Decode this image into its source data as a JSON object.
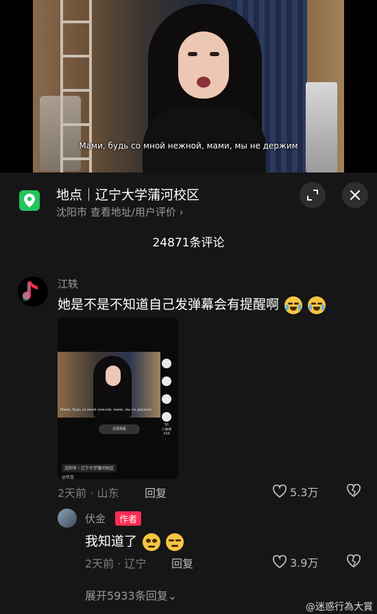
{
  "video": {
    "subtitle": "Мами, будь со мной нежной, мами, мы не держим"
  },
  "location": {
    "title": "地点｜辽宁大学蒲河校区",
    "subtitle": "沈阳市  查看地址/用户评价 ›",
    "icon": "map-pin-icon",
    "accent_color": "#22c55e"
  },
  "comments_header": {
    "count_label": "24871条评论"
  },
  "comment": {
    "username": "江轶",
    "text": "她是不是不知道自己发弹幕会有提醒啊",
    "thumbnail": {
      "subtitle": "Мами, будь со мной нежной, мами, мы не держим",
      "location": "沈阳市｜辽宁大学蒲河校区",
      "user": "@伏金",
      "rail_counts": [
        "56",
        "少推荐",
        "438"
      ],
      "button": "全屏观看"
    },
    "time_location": "2天前 · 山东",
    "reply_label": "回复",
    "likes": "5.3万"
  },
  "reply": {
    "username": "伏金",
    "author_badge": "作者",
    "text": "我知道了",
    "time_location": "2天前 · 辽宁",
    "reply_label": "回复",
    "likes": "3.9万",
    "author_badge_color": "#ff2d55"
  },
  "expand_replies": "展开5933条回复⌄",
  "watermark": "@迷惑行為大賞"
}
